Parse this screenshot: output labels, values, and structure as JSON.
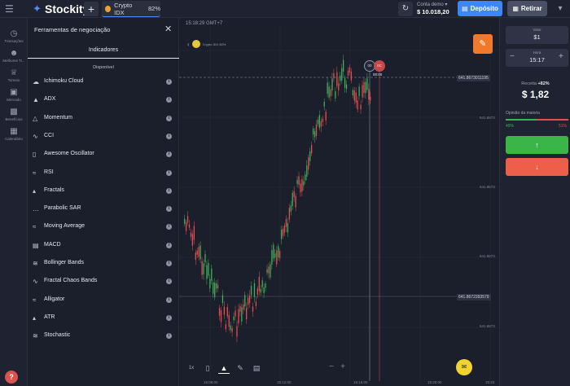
{
  "header": {
    "brand": "Stockity",
    "asset_tab": {
      "name": "Crypto IDX",
      "payout": "82%"
    },
    "account_label": "Conta demo",
    "balance": "$ 10.018,20",
    "deposit_label": "Depósito",
    "withdraw_label": "Retirar"
  },
  "nav": {
    "items": [
      {
        "label": "Transações",
        "icon": "clock-icon"
      },
      {
        "label": "Melhores Tr...",
        "icon": "users-icon"
      },
      {
        "label": "Torneio",
        "icon": "trophy-icon"
      },
      {
        "label": "Mercado",
        "icon": "cart-icon"
      },
      {
        "label": "Benefícios",
        "icon": "gift-icon"
      },
      {
        "label": "Calendário",
        "icon": "calendar-icon"
      }
    ]
  },
  "panel": {
    "title": "Ferramentas de negociação",
    "tab": "Indicadores",
    "section": "Disponível",
    "indicators": [
      "Ichimoku Cloud",
      "ADX",
      "Momentum",
      "CCI",
      "Awesome Oscillator",
      "RSI",
      "Fractals",
      "Parabolic SAR",
      "Moving Average",
      "MACD",
      "Bollinger Bands",
      "Fractal Chaos Bands",
      "Alligator",
      "ATR",
      "Stochastic"
    ]
  },
  "chart": {
    "clock": "15:18:29 GMT+7",
    "asset_label": "Crypto IDX 80%",
    "timer_a": "00",
    "timer_b": "0C",
    "timer_c": "00:00",
    "current_price": "641.8673011195",
    "line_price": "641.8672393579",
    "axis_prices": [
      "641.8673",
      "641.8673",
      "641.8673",
      "641.8673",
      "641.8673",
      "641.8673"
    ],
    "times": [
      "15:08:00",
      "15:12:00",
      "15:16:00",
      "15:20:00",
      "15:23"
    ],
    "zoom_level": "1x"
  },
  "trade": {
    "amount_label": "Valor",
    "amount": "$1",
    "time_label": "Hora",
    "time": "15:17",
    "profit_label": "Receita",
    "profit_pct": "+82%",
    "profit_value": "$ 1,82",
    "opinion_label": "Opinião da maioria",
    "opinion_up": "49%",
    "opinion_down": "51%",
    "opinion_up_fraction": 0.49
  },
  "colors": {
    "accent": "#3d86f5",
    "up": "#3cb548",
    "down": "#ee5f4a",
    "candle_up": "#3cb05a",
    "candle_down": "#e05050"
  }
}
